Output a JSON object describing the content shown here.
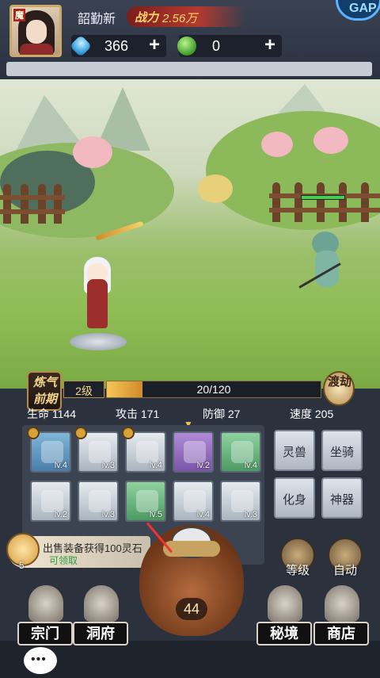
{
  "header": {
    "avatar_tag": "魔",
    "player_name": "韶勤新",
    "power_label": "战力",
    "power_value": "2.56万",
    "corner_button": "GAP"
  },
  "resources": {
    "gem": {
      "value": "366",
      "plus": "+",
      "icon": "blue-gem-icon"
    },
    "leaf": {
      "value": "0",
      "plus": "+",
      "icon": "green-swirl-icon"
    }
  },
  "battle": {
    "enemy_hp_fraction": 1.0
  },
  "cultivation": {
    "realm": "炼气前期",
    "level": "2级",
    "exp_current": 20,
    "exp_max": 120,
    "exp_text": "20/120",
    "breakthrough_label": "渡劫"
  },
  "stats": [
    {
      "label": "生命",
      "value": "1144"
    },
    {
      "label": "攻击",
      "value": "171"
    },
    {
      "label": "防御",
      "value": "27"
    },
    {
      "label": "速度",
      "value": "205"
    }
  ],
  "equipment": [
    {
      "name": "sword",
      "level": "lv.4",
      "quality": "blue",
      "starred": true
    },
    {
      "name": "hat",
      "level": "lv.3",
      "quality": "white",
      "starred": true
    },
    {
      "name": "hair",
      "level": "lv.4",
      "quality": "white",
      "starred": true
    },
    {
      "name": "armor",
      "level": "lv.2",
      "quality": "purple",
      "starred": false
    },
    {
      "name": "ring",
      "level": "lv.4",
      "quality": "green",
      "starred": false
    },
    {
      "name": "boots",
      "level": "lv.2",
      "quality": "white",
      "starred": false
    },
    {
      "name": "necklace",
      "level": "lv.3",
      "quality": "white",
      "starred": false
    },
    {
      "name": "pendant",
      "level": "lv.5",
      "quality": "green",
      "starred": false
    },
    {
      "name": "belt",
      "level": "lv.4",
      "quality": "white",
      "starred": false
    },
    {
      "name": "pants",
      "level": "lv.3",
      "quality": "white",
      "starred": false
    }
  ],
  "side_buttons": [
    "灵兽",
    "坐骑",
    "化身",
    "神器"
  ],
  "task": {
    "count": "5",
    "text": "出售装备获得100灵石",
    "status": "可领取"
  },
  "round_buttons": [
    {
      "label": "等级"
    },
    {
      "label": "自动"
    }
  ],
  "bag": {
    "count": "44"
  },
  "nav": [
    "宗门",
    "洞府",
    "秘境",
    "商店"
  ],
  "chat": {
    "label": "•••"
  },
  "colors": {
    "accent_gold": "#f6c656",
    "hp_green": "#3fd24b",
    "power_red": "#b33a2e"
  }
}
